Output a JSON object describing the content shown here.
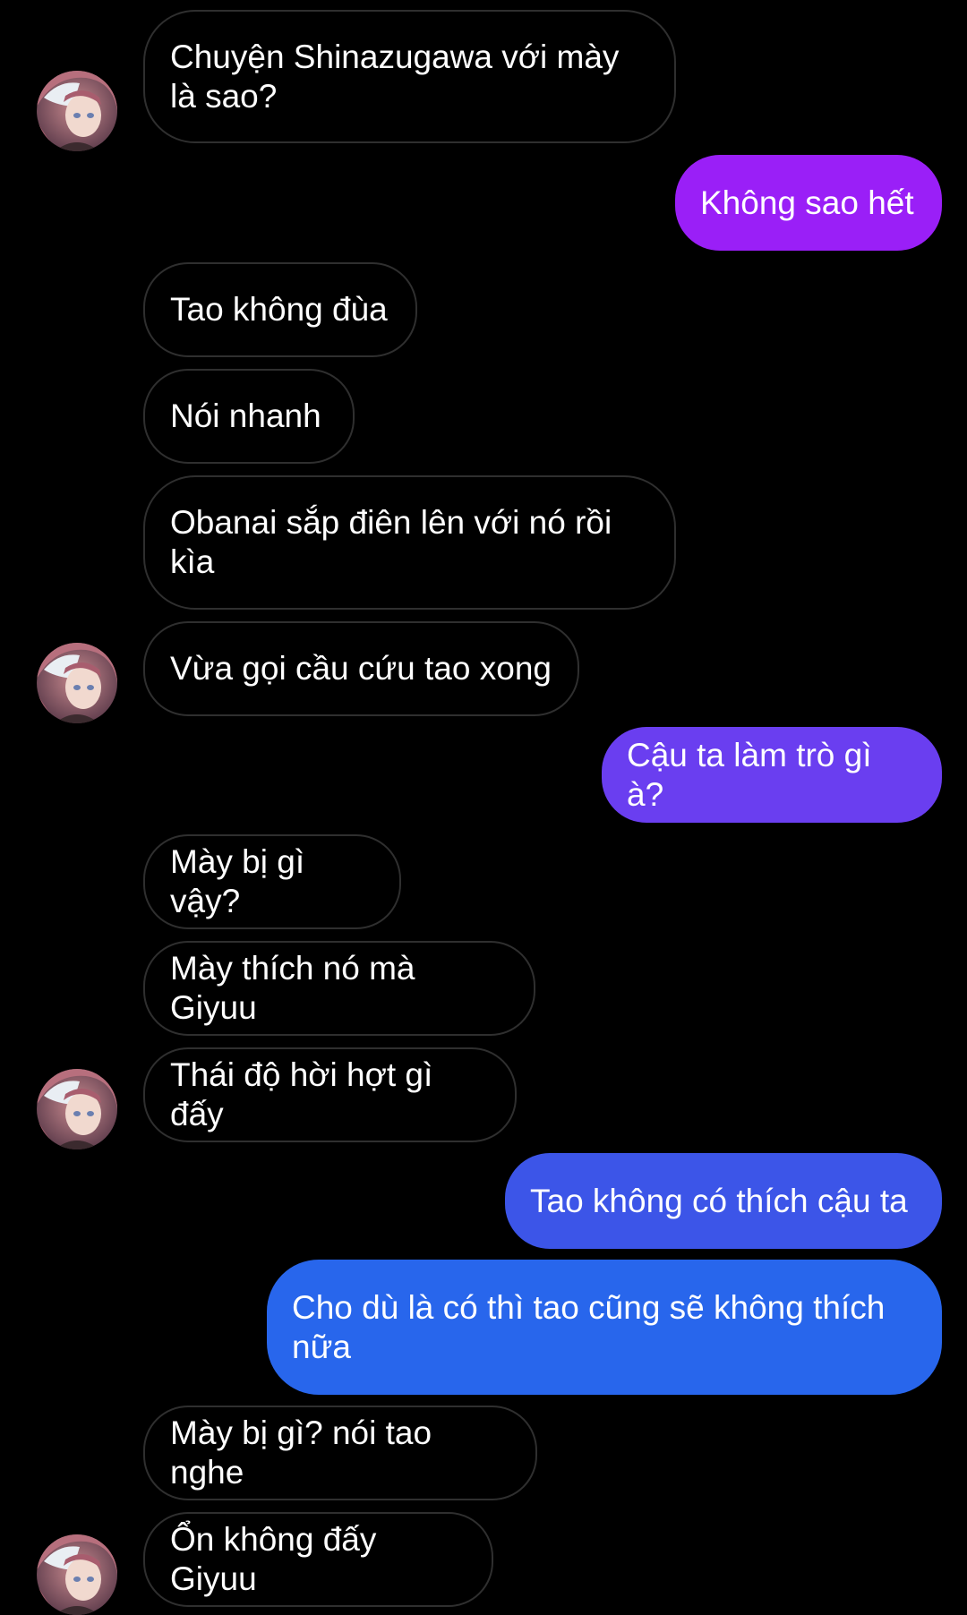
{
  "conversation": {
    "incoming_bubble_border": "#2f2f2f",
    "outgoing_gradient": [
      "#9a1ff7",
      "#6a3ef0",
      "#3c55e8",
      "#2866ec"
    ],
    "messages": [
      {
        "side": "in",
        "text": "Chuyện Shinazugawa với mày là sao?"
      },
      {
        "side": "out",
        "text": "Không sao hết"
      },
      {
        "side": "in",
        "text": "Tao không đùa"
      },
      {
        "side": "in",
        "text": "Nói nhanh"
      },
      {
        "side": "in",
        "text": "Obanai sắp điên lên với nó rồi kìa"
      },
      {
        "side": "in",
        "text": "Vừa gọi cầu cứu tao xong"
      },
      {
        "side": "out",
        "text": "Cậu ta làm trò gì à?"
      },
      {
        "side": "in",
        "text": "Mày bị gì vậy?"
      },
      {
        "side": "in",
        "text": "Mày thích nó mà Giyuu"
      },
      {
        "side": "in",
        "text": "Thái độ hời hợt gì đấy"
      },
      {
        "side": "out",
        "text": "Tao không có thích cậu ta"
      },
      {
        "side": "out",
        "text": "Cho dù là có thì tao cũng sẽ không thích nữa"
      },
      {
        "side": "in",
        "text": "Mày bị gì? nói tao nghe"
      },
      {
        "side": "in",
        "text": "Ổn không đấy Giyuu"
      }
    ]
  }
}
